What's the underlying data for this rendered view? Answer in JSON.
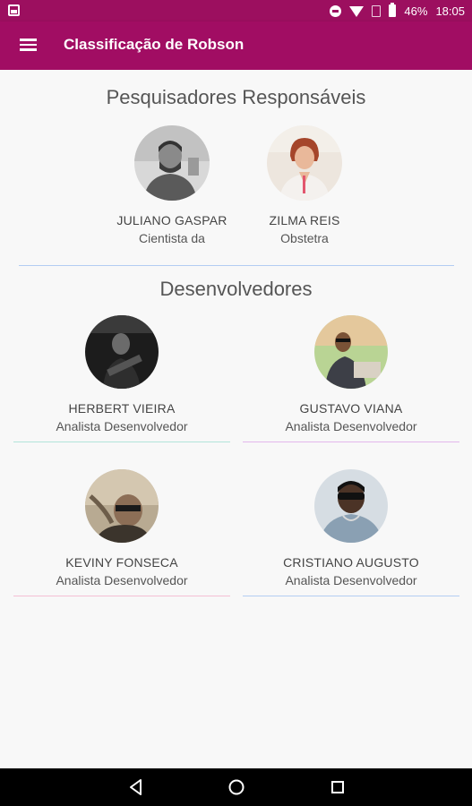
{
  "status_bar": {
    "battery": "46%",
    "time": "18:05"
  },
  "app_bar": {
    "title": "Classificação de Robson"
  },
  "researchers": {
    "title": "Pesquisadores Responsáveis",
    "people": [
      {
        "name": "JULIANO GASPAR",
        "role": "Cientista da"
      },
      {
        "name": "ZILMA REIS",
        "role": "Obstetra"
      }
    ]
  },
  "developers": {
    "title": "Desenvolvedores",
    "people": [
      {
        "name": "HERBERT VIEIRA",
        "role": "Analista Desenvolvedor"
      },
      {
        "name": "GUSTAVO VIANA",
        "role": "Analista Desenvolvedor"
      },
      {
        "name": "KEVINY FONSECA",
        "role": "Analista Desenvolvedor"
      },
      {
        "name": "CRISTIANO AUGUSTO",
        "role": "Analista Desenvolvedor"
      }
    ]
  },
  "colors": {
    "primary": "#a10d63",
    "status_bar": "#9c0f5f",
    "divider_blue": "#b3cdf2",
    "divider_teal": "#b2e5da",
    "divider_violet": "#e3b8ec",
    "divider_pink": "#f4bfd4"
  }
}
